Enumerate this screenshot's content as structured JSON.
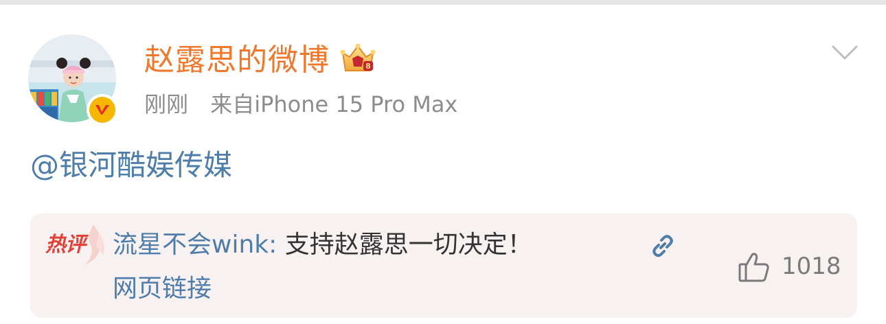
{
  "post": {
    "username": "赵露思的微博",
    "time": "刚刚",
    "source": "来自iPhone 15 Pro Max",
    "mention": "@银河酷娱传媒"
  },
  "hot_comment": {
    "badge": "热评",
    "author": "流星不会wink",
    "separator": ": ",
    "text": "支持赵露思一切决定！",
    "link_text": "网页链接",
    "like_count": "1018"
  },
  "icons": {
    "crown": "crown-badge-icon",
    "verified": "verified-badge-icon",
    "chevron": "chevron-down-icon",
    "link": "link-icon",
    "like": "thumbs-up-icon"
  },
  "colors": {
    "username": "#f0782d",
    "link_blue": "#4e7da9",
    "meta_gray": "#8c8c8c",
    "hot_badge_red": "#e0423a",
    "comment_bg": "#f8f1f1"
  }
}
